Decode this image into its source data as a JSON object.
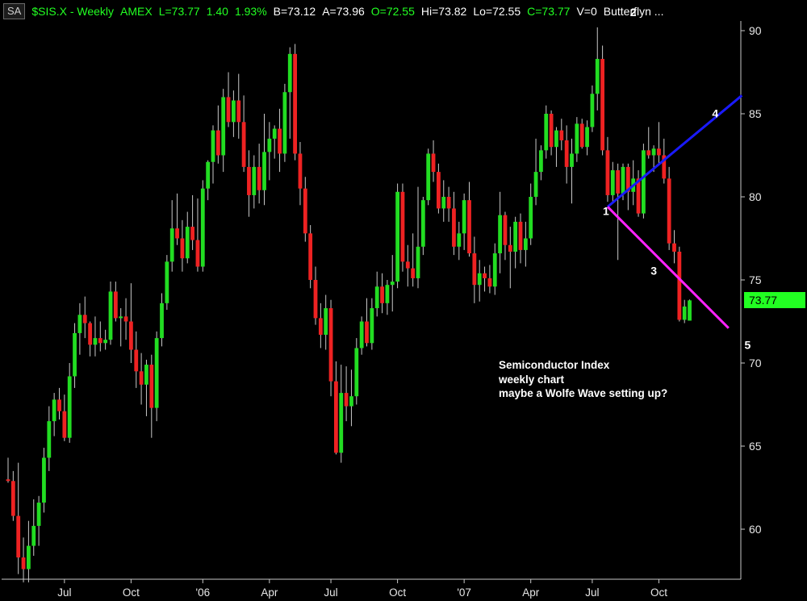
{
  "header": {
    "badge": "SA",
    "items": [
      {
        "text": "$SIS.X - Weekly",
        "color": "#22ff22"
      },
      {
        "text": "AMEX",
        "color": "#22ff22"
      },
      {
        "text": "L=73.77",
        "color": "#22ff22"
      },
      {
        "text": "1.40",
        "color": "#22ff22"
      },
      {
        "text": "1.93%",
        "color": "#22ff22"
      },
      {
        "text": "B=73.12",
        "color": "#ffffff"
      },
      {
        "text": "A=73.96",
        "color": "#ffffff"
      },
      {
        "text": "O=72.55",
        "color": "#22ff22"
      },
      {
        "text": "Hi=73.82",
        "color": "#ffffff"
      },
      {
        "text": "Lo=72.55",
        "color": "#ffffff"
      },
      {
        "text": "C=73.77",
        "color": "#22ff22"
      },
      {
        "text": "V=0",
        "color": "#ffffff"
      },
      {
        "text": "Butterflyn ...",
        "color": "#ffffff"
      }
    ]
  },
  "annotation": {
    "lines": [
      "Semiconductor Index",
      "weekly chart",
      "maybe a Wolfe Wave setting up?"
    ]
  },
  "last_price_tag": "73.77",
  "colors": {
    "up": "#22dd22",
    "down": "#ee2222",
    "wick": "#c8c8c8",
    "axis": "#c8c8c8",
    "line_1_4": "#1a1aff",
    "line_1_5": "#ff22ff",
    "price_tag": "#22ff22"
  },
  "chart_data": {
    "type": "candlestick",
    "title": "$SIS.X - Weekly",
    "ylim": [
      56.6,
      91.5
    ],
    "y_ticks": [
      60,
      65,
      70,
      75,
      80,
      85,
      90
    ],
    "x_tick_labels": [
      {
        "label": "Jul",
        "bar": 11
      },
      {
        "label": "Oct",
        "bar": 24
      },
      {
        "label": "'06",
        "bar": 38
      },
      {
        "label": "Apr",
        "bar": 51
      },
      {
        "label": "Jul",
        "bar": 63
      },
      {
        "label": "Oct",
        "bar": 76
      },
      {
        "label": "'07",
        "bar": 89
      },
      {
        "label": "Apr",
        "bar": 102
      },
      {
        "label": "Jul",
        "bar": 114
      },
      {
        "label": "Oct",
        "bar": 127
      }
    ],
    "candles": [
      [
        63,
        64.3,
        62.8,
        62.9
      ],
      [
        62.9,
        63.5,
        60.5,
        60.8
      ],
      [
        60.8,
        64.0,
        57.3,
        58.3
      ],
      [
        58.3,
        59.5,
        56.8,
        57.6
      ],
      [
        57.6,
        60.5,
        56.8,
        59.0
      ],
      [
        59.0,
        61.8,
        58.4,
        60.2
      ],
      [
        60.2,
        62.0,
        59.0,
        61.6
      ],
      [
        61.6,
        64.9,
        61.0,
        64.3
      ],
      [
        64.3,
        67.4,
        63.5,
        66.5
      ],
      [
        66.5,
        68.2,
        65.6,
        67.8
      ],
      [
        67.8,
        68.5,
        66.6,
        67.1
      ],
      [
        67.1,
        68.1,
        65.3,
        65.5
      ],
      [
        65.5,
        70.0,
        65.2,
        69.2
      ],
      [
        69.2,
        72.4,
        68.5,
        71.8
      ],
      [
        71.8,
        73.6,
        70.5,
        72.9
      ],
      [
        72.9,
        74.0,
        71.5,
        72.4
      ],
      [
        72.4,
        72.5,
        70.4,
        71.1
      ],
      [
        71.1,
        72.8,
        70.4,
        71.5
      ],
      [
        71.5,
        72.5,
        70.7,
        71.2
      ],
      [
        71.2,
        72.0,
        70.8,
        71.4
      ],
      [
        71.4,
        74.9,
        71.1,
        74.3
      ],
      [
        74.3,
        74.9,
        72.5,
        72.7
      ],
      [
        72.7,
        73.3,
        71.0,
        72.8
      ],
      [
        72.8,
        73.9,
        71.4,
        72.5
      ],
      [
        72.5,
        74.8,
        70.0,
        70.8
      ],
      [
        70.8,
        71.9,
        68.5,
        69.5
      ],
      [
        69.5,
        70.6,
        67.5,
        68.7
      ],
      [
        68.7,
        70.2,
        66.8,
        69.9
      ],
      [
        69.9,
        70.5,
        65.5,
        67.3
      ],
      [
        67.3,
        71.9,
        66.5,
        71.5
      ],
      [
        71.5,
        74.2,
        71.0,
        73.6
      ],
      [
        73.6,
        76.5,
        73.2,
        76.1
      ],
      [
        76.1,
        79.8,
        75.5,
        78.1
      ],
      [
        78.1,
        80.2,
        77.1,
        77.5
      ],
      [
        77.5,
        78.6,
        75.5,
        76.3
      ],
      [
        76.3,
        79.1,
        76.0,
        78.2
      ],
      [
        78.2,
        80.1,
        76.8,
        77.4
      ],
      [
        77.4,
        79.9,
        75.5,
        75.8
      ],
      [
        75.8,
        81.0,
        75.5,
        80.5
      ],
      [
        80.5,
        82.2,
        79.8,
        82.1
      ],
      [
        82.1,
        84.3,
        80.8,
        84.0
      ],
      [
        84.0,
        85.5,
        82.0,
        82.5
      ],
      [
        82.5,
        86.5,
        81.5,
        86.0
      ],
      [
        86.0,
        87.5,
        84.2,
        84.5
      ],
      [
        84.5,
        86.4,
        83.6,
        85.8
      ],
      [
        85.8,
        87.4,
        83.5,
        84.5
      ],
      [
        84.5,
        86.1,
        81.5,
        81.8
      ],
      [
        81.8,
        82.8,
        78.8,
        80.1
      ],
      [
        80.1,
        82.5,
        79.3,
        81.8
      ],
      [
        81.8,
        83.2,
        79.6,
        80.4
      ],
      [
        80.4,
        85.0,
        79.5,
        82.7
      ],
      [
        82.7,
        84.5,
        81.0,
        83.5
      ],
      [
        83.5,
        84.3,
        82.3,
        84.1
      ],
      [
        84.1,
        85.3,
        81.5,
        82.6
      ],
      [
        82.6,
        86.8,
        82.1,
        86.3
      ],
      [
        86.3,
        89.0,
        83.5,
        88.6
      ],
      [
        88.6,
        89.2,
        82.2,
        82.6
      ],
      [
        82.6,
        83.3,
        79.5,
        80.5
      ],
      [
        80.5,
        81.2,
        77.3,
        77.8
      ],
      [
        77.8,
        78.3,
        74.5,
        75.0
      ],
      [
        75.0,
        75.8,
        72.3,
        72.7
      ],
      [
        72.7,
        73.6,
        70.9,
        71.7
      ],
      [
        71.7,
        74.1,
        70.8,
        73.3
      ],
      [
        73.3,
        73.8,
        68.0,
        68.9
      ],
      [
        68.9,
        70.1,
        64.5,
        64.6
      ],
      [
        64.6,
        69.9,
        64.0,
        68.2
      ],
      [
        68.2,
        69.8,
        66.5,
        67.4
      ],
      [
        67.4,
        69.6,
        66.2,
        68.0
      ],
      [
        68.0,
        71.5,
        67.5,
        70.9
      ],
      [
        70.9,
        72.8,
        70.5,
        72.5
      ],
      [
        72.5,
        73.9,
        71.0,
        71.2
      ],
      [
        71.2,
        73.9,
        70.8,
        73.3
      ],
      [
        73.3,
        75.5,
        72.8,
        74.6
      ],
      [
        74.6,
        75.4,
        73.0,
        73.6
      ],
      [
        73.6,
        75.0,
        72.9,
        74.7
      ],
      [
        74.7,
        76.5,
        73.1,
        74.9
      ],
      [
        74.9,
        80.8,
        74.5,
        80.3
      ],
      [
        80.3,
        80.8,
        75.5,
        76.1
      ],
      [
        76.1,
        77.1,
        74.6,
        75.7
      ],
      [
        75.7,
        77.8,
        74.6,
        75.1
      ],
      [
        75.1,
        80.6,
        74.5,
        77.0
      ],
      [
        77.0,
        80.0,
        76.5,
        79.8
      ],
      [
        79.8,
        82.9,
        79.5,
        82.6
      ],
      [
        82.6,
        83.4,
        80.9,
        81.5
      ],
      [
        81.5,
        82.0,
        79.0,
        79.3
      ],
      [
        79.3,
        81.0,
        78.5,
        80.0
      ],
      [
        80.0,
        80.6,
        78.5,
        79.3
      ],
      [
        79.3,
        80.3,
        76.5,
        77.0
      ],
      [
        77.0,
        78.5,
        76.2,
        77.8
      ],
      [
        77.8,
        80.2,
        76.8,
        79.8
      ],
      [
        79.8,
        80.9,
        76.4,
        76.6
      ],
      [
        76.6,
        77.6,
        73.6,
        74.7
      ],
      [
        74.7,
        76.2,
        73.7,
        75.4
      ],
      [
        75.4,
        75.8,
        74.3,
        75.1
      ],
      [
        75.1,
        75.9,
        74.2,
        74.6
      ],
      [
        74.6,
        77.2,
        74.1,
        76.6
      ],
      [
        76.6,
        80.3,
        75.4,
        78.9
      ],
      [
        78.9,
        79.1,
        76.2,
        77.1
      ],
      [
        77.1,
        78.2,
        74.5,
        76.7
      ],
      [
        76.7,
        78.8,
        75.7,
        78.5
      ],
      [
        78.5,
        79.0,
        76.0,
        76.8
      ],
      [
        76.8,
        78.5,
        75.8,
        77.5
      ],
      [
        77.5,
        80.8,
        77.1,
        80.0
      ],
      [
        80.0,
        83.5,
        79.5,
        81.5
      ],
      [
        81.5,
        83.1,
        81.0,
        82.8
      ],
      [
        82.8,
        85.5,
        82.3,
        85.0
      ],
      [
        85.0,
        85.2,
        82.5,
        83.0
      ],
      [
        83.0,
        84.2,
        81.8,
        84.0
      ],
      [
        84.0,
        84.7,
        82.8,
        83.4
      ],
      [
        83.4,
        84.3,
        80.8,
        81.8
      ],
      [
        81.8,
        83.5,
        79.6,
        82.6
      ],
      [
        82.6,
        84.8,
        82.1,
        84.4
      ],
      [
        84.4,
        84.7,
        82.9,
        83.0
      ],
      [
        83.0,
        84.6,
        82.5,
        84.2
      ],
      [
        84.2,
        86.7,
        83.9,
        86.2
      ],
      [
        86.2,
        90.2,
        85.2,
        88.3
      ],
      [
        88.3,
        89.1,
        82.5,
        82.8
      ],
      [
        82.8,
        83.6,
        79.7,
        80.1
      ],
      [
        80.1,
        82.1,
        79.6,
        81.6
      ],
      [
        81.6,
        82.0,
        76.2,
        80.2
      ],
      [
        80.2,
        82.0,
        79.8,
        81.8
      ],
      [
        81.8,
        82.0,
        79.2,
        80.3
      ],
      [
        80.3,
        82.2,
        79.5,
        81.1
      ],
      [
        81.1,
        81.6,
        78.8,
        79.0
      ],
      [
        79.0,
        83.2,
        78.7,
        82.8
      ],
      [
        82.8,
        84.2,
        82.3,
        82.5
      ],
      [
        82.5,
        83.1,
        81.5,
        82.9
      ],
      [
        82.9,
        84.5,
        82.0,
        82.5
      ],
      [
        82.5,
        83.5,
        80.8,
        81.1
      ],
      [
        81.1,
        81.8,
        76.8,
        77.2
      ],
      [
        77.2,
        78.0,
        76.0,
        76.7
      ],
      [
        76.7,
        77.0,
        72.5,
        72.6
      ],
      [
        72.6,
        73.8,
        72.4,
        73.4
      ],
      [
        72.55,
        73.82,
        72.55,
        73.77
      ]
    ],
    "wave_points": [
      {
        "label": "1",
        "bar": 117,
        "price": 79.4
      },
      {
        "label": "2",
        "bar": 122,
        "price": 90.2
      },
      {
        "label": "3",
        "bar": 126,
        "price": 76.2
      },
      {
        "label": "4",
        "bar": 138,
        "price": 84.3
      },
      {
        "label": "5",
        "bar": 144,
        "price": 72.2
      }
    ],
    "trend_lines": [
      {
        "name": "1-4 line",
        "from": {
          "bar": 117,
          "price": 79.4
        },
        "to": {
          "bar": 143.2,
          "price": 86.1
        }
      },
      {
        "name": "1-5 line",
        "from": {
          "bar": 117,
          "price": 79.4
        },
        "to": {
          "bar": 140.6,
          "price": 72.1
        }
      }
    ]
  }
}
